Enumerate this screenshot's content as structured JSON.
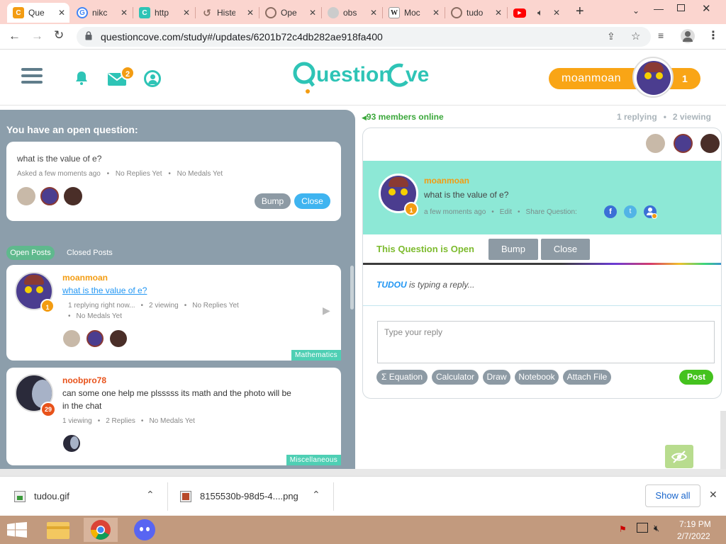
{
  "browser": {
    "tabs": [
      {
        "label": "Que",
        "active": true,
        "favicon": "questioncove-icon",
        "color": "#f39c12"
      },
      {
        "label": "nikc",
        "favicon": "google-icon",
        "color": "#4285f4"
      },
      {
        "label": "http",
        "favicon": "questioncove-teal-icon",
        "color": "#2ec4b6"
      },
      {
        "label": "Histe",
        "favicon": "history-icon",
        "color": "#8a6d62"
      },
      {
        "label": "Ope",
        "favicon": "globe-icon",
        "color": "#8a6d62"
      },
      {
        "label": "obs",
        "favicon": "globe-icon",
        "color": "#999999"
      },
      {
        "label": "Moc",
        "favicon": "wikipedia-icon",
        "color": "#333333"
      },
      {
        "label": "tudo",
        "favicon": "globe-icon",
        "color": "#8a6d62"
      },
      {
        "label": "",
        "favicon": "youtube-icon",
        "color": "#ff0000"
      }
    ],
    "url": "questioncove.com/study#/updates/6201b72c4db282ae918fa400"
  },
  "header": {
    "logo": "QuestionCove",
    "mail_count": "2",
    "username": "moanmoan",
    "user_score": "1"
  },
  "left_panel": {
    "open_question_heading": "You have an open question:",
    "open_question": {
      "text": "what is the value of e?",
      "meta": [
        "Asked a few moments ago",
        "No Replies Yet",
        "No Medals Yet"
      ],
      "bump_label": "Bump",
      "close_label": "Close"
    },
    "tabs": {
      "open": "Open Posts",
      "closed": "Closed Posts"
    },
    "posts": [
      {
        "user": "moanmoan",
        "score": "1",
        "question": "what is the value of e?",
        "meta_line1": [
          "1 replying right now...",
          "2 viewing",
          "No Replies Yet"
        ],
        "meta_line2": "No Medals Yet",
        "subject": "Mathematics"
      },
      {
        "user": "noobpro78",
        "score": "29",
        "question_line1": "can some one help me plsssss its math and the photo will be",
        "question_line2": "in the chat",
        "meta": [
          "1 viewing",
          "2 Replies",
          "No Medals Yet"
        ],
        "subject": "Miscellaneous"
      }
    ]
  },
  "right_panel": {
    "members_online": "93 members online",
    "replying": "1 replying",
    "viewing": "2 viewing",
    "question": {
      "user": "moanmoan",
      "text": "what is the value of e?",
      "time": "a few moments ago",
      "edit": "Edit",
      "share": "Share Question:",
      "score": "1"
    },
    "status": "This Question is Open",
    "bump_label": "Bump",
    "close_label": "Close",
    "typing_user": "TUDOU",
    "typing_text": "is typing a reply...",
    "reply_placeholder": "Type your reply",
    "tools": [
      "Σ  Equation",
      "Calculator",
      "Draw",
      "Notebook",
      "Attach File"
    ],
    "post_label": "Post"
  },
  "downloads": {
    "items": [
      "tudou.gif",
      "8155530b-98d5-4....png"
    ],
    "show_all": "Show all"
  },
  "taskbar": {
    "time": "7:19 PM",
    "date": "2/7/2022"
  },
  "colors": {
    "accent_teal": "#2ec4b6",
    "user_orange": "#f39c12",
    "panel_grey": "#8c9eab",
    "question_bg": "#8de8d6",
    "post_green": "#44c21e",
    "tab_bar": "#fbd5cf",
    "taskbar": "#c29a7e"
  }
}
